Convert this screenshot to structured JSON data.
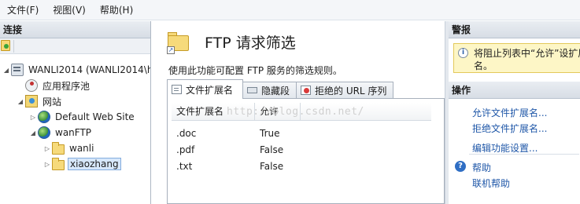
{
  "menu": {
    "file": "文件(F)",
    "view": "视图(V)",
    "help": "帮助(H)"
  },
  "left": {
    "header": "连接",
    "tree": {
      "server": "WANLI2014 (WANLI2014\\h",
      "app_pools": "应用程序池",
      "sites": "网站",
      "default_site": "Default Web Site",
      "ftp_site": "wanFTP",
      "folder1": "wanli",
      "folder2": "xiaozhang"
    }
  },
  "center": {
    "title": "FTP 请求筛选",
    "description": "使用此功能可配置 FTP 服务的筛选规则。",
    "tabs": [
      {
        "label": "文件扩展名",
        "icon": "document-icon"
      },
      {
        "label": "隐藏段",
        "icon": "segment-icon"
      },
      {
        "label": "拒绝的 URL 序列",
        "icon": "deny-icon"
      }
    ],
    "grid": {
      "columns": [
        "文件扩展名",
        "允许"
      ],
      "rows": [
        {
          "ext": ".doc",
          "allowed": "True"
        },
        {
          "ext": ".pdf",
          "allowed": "False"
        },
        {
          "ext": ".txt",
          "allowed": "False"
        }
      ]
    },
    "watermark": "http://blog.csdn.net/"
  },
  "right": {
    "alerts_header": "警报",
    "alert_text": "将阻止列表中“允许”设扩展名。",
    "actions_header": "操作",
    "actions": {
      "allow_ext": "允许文件扩展名...",
      "deny_ext": "拒绝文件扩展名...",
      "edit_settings": "编辑功能设置...",
      "help": "帮助",
      "online_help": "联机帮助"
    }
  }
}
